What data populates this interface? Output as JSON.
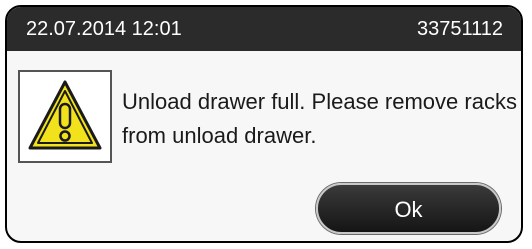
{
  "header": {
    "datetime": "22.07.2014 12:01",
    "serial": "33751112"
  },
  "message": {
    "icon": "warning-icon",
    "text": "Unload drawer full. Please remove racks from unload drawer."
  },
  "buttons": {
    "ok_label": "Ok"
  },
  "colors": {
    "titlebar": "#2b2b2b",
    "warning_yellow": "#f2e21c",
    "button": "#1f1f1f"
  }
}
